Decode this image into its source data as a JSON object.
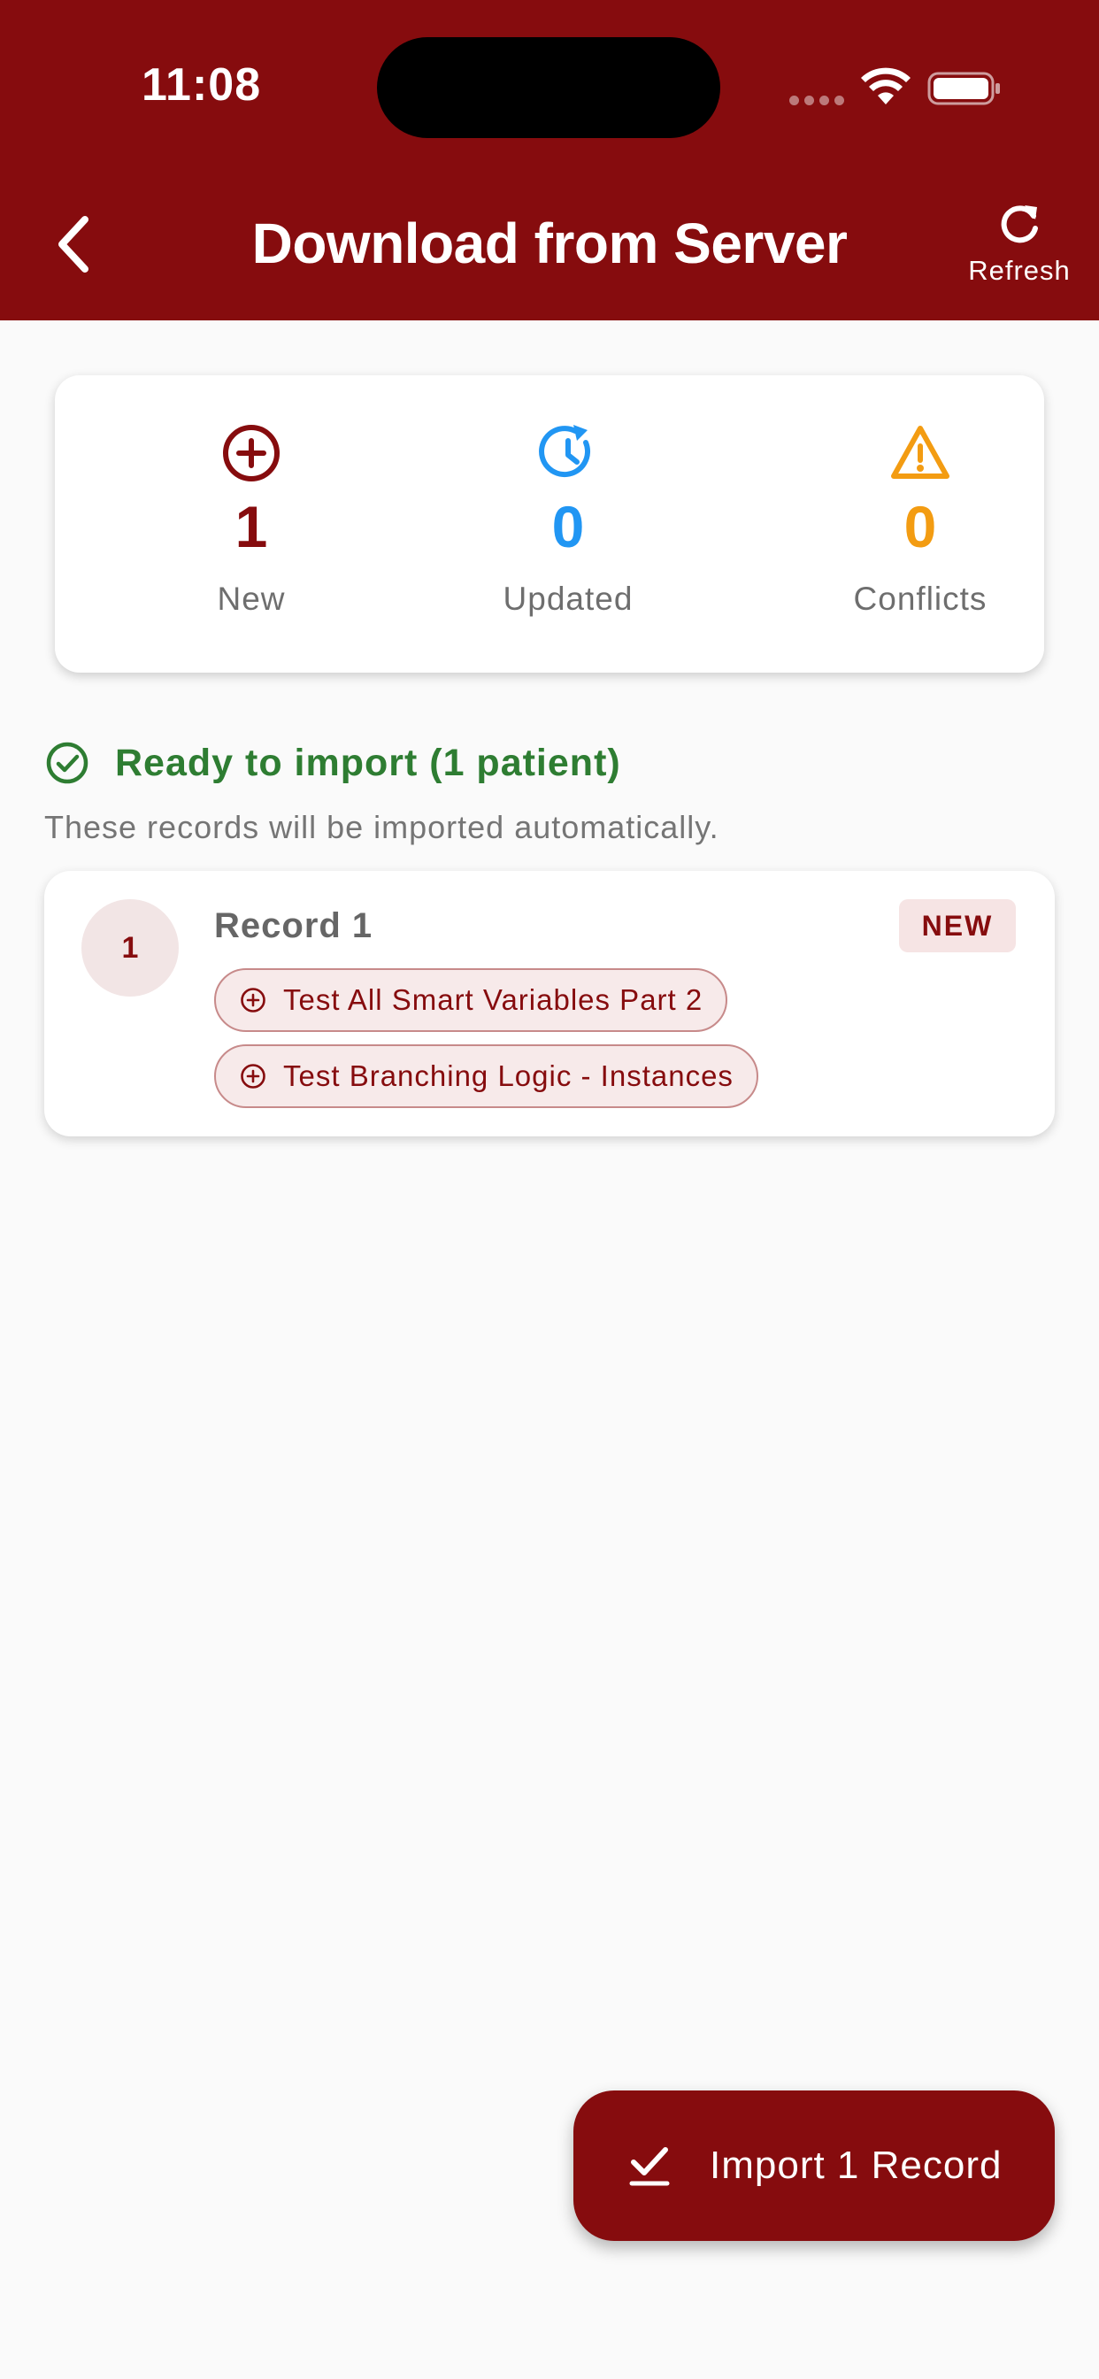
{
  "status_bar": {
    "time": "11:08",
    "icons": [
      "signal-dots-icon",
      "wifi-icon",
      "battery-icon"
    ]
  },
  "header": {
    "title": "Download from Server",
    "back_icon": "chevron-left-icon",
    "refresh_label": "Refresh",
    "refresh_icon": "refresh-icon"
  },
  "summary": {
    "stats": [
      {
        "icon": "add-circle-icon",
        "value": "1",
        "label": "New",
        "color": "#860c0e"
      },
      {
        "icon": "updated-clock-icon",
        "value": "0",
        "label": "Updated",
        "color": "#2196f3"
      },
      {
        "icon": "warning-icon",
        "value": "0",
        "label": "Conflicts",
        "color": "#f39c12"
      }
    ]
  },
  "ready": {
    "icon": "check-circle-icon",
    "heading": "Ready to import (1 patient)",
    "subtitle": "These records will be imported automatically."
  },
  "records": [
    {
      "index": "1",
      "name": "Record 1",
      "badge": "NEW",
      "instruments": [
        "Test All Smart Variables Part 2",
        "Test Branching Logic - Instances"
      ]
    }
  ],
  "fab": {
    "icon": "done-icon",
    "label": "Import 1 Record"
  },
  "colors": {
    "brand": "#860c0e",
    "success": "#2e7d32",
    "info": "#2196f3",
    "warning": "#f39c12",
    "background": "#fafafa"
  }
}
